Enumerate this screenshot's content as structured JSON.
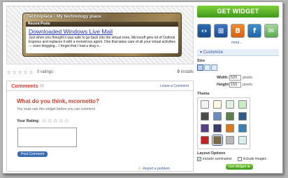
{
  "preview": {
    "gadget_title": "TechnIplace - My technology place",
    "section_label": "Recent Posts",
    "post_title": "Downloaded Windows Live Mail",
    "post_text": "Just when you thought it was safe to go back into the virtual zone, Microsoft gets rid of Outlook Express and replaces it with a monstrous agent.  One that takes care of all your virtual activities --- even blogging... I forgot that I had a blog o..."
  },
  "rating": {
    "label": "0 ratings",
    "installs_count": "0",
    "installs_label": "installs"
  },
  "comments": {
    "title": "Comments",
    "count": "(0)",
    "leave_label": "Leave a Comment",
    "ask": "What do you think, mcornetto?",
    "must_rate": "You must rate this widget before you can comment",
    "your_rating": "Your Rating:",
    "post_button": "Post Comment",
    "report_label": "Report a problem"
  },
  "sidebar": {
    "get_widget": "GET WIDGET",
    "more": "more...",
    "customize": "Customize",
    "size_label": "Size",
    "width_label": "Width:",
    "width_value": "520",
    "height_label": "Height:",
    "height_value": "150",
    "unit": "pixels",
    "theme_label": "Theme",
    "themes": [
      "#f2f2f2",
      "#fff8e0",
      "#dff0e4",
      "#c9ecc2",
      "#4a4a4a",
      "#6b8bbf",
      "#5f7e4e",
      "#2e5b88",
      "#5b3c86",
      "#3a3c6a",
      "#d9781c",
      "#3c7fb6",
      "#c42323",
      "#7e6a46",
      "#b8b8b8",
      "#d6f0f2"
    ],
    "selected_theme": 13,
    "layout_label": "Layout Options",
    "summaries_label": "include summaries",
    "summaries_checked": true,
    "images_label": "include images",
    "images_checked": false,
    "get_widget_small": "Get Widget"
  },
  "colors": {
    "accent_green": "#4aa82a",
    "comment_red": "#e03a2b",
    "link_blue": "#3b5998"
  }
}
